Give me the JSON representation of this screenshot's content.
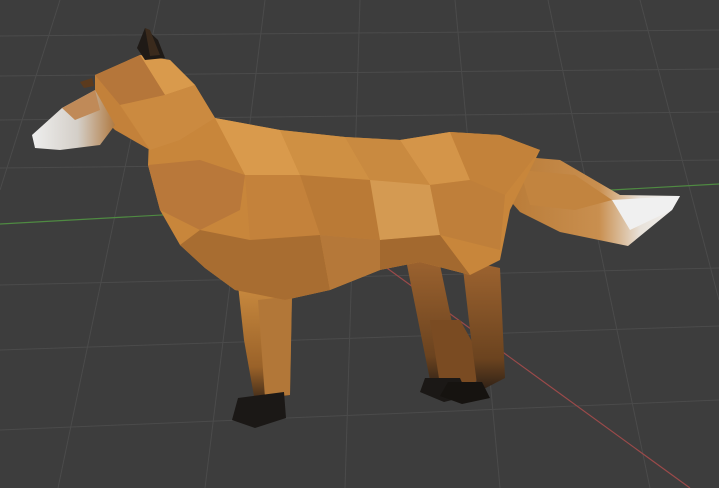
{
  "viewport": {
    "background_color": "#3d3d3d",
    "grid_color": "#4a4a4a",
    "x_axis_color": "#9b4a4a",
    "y_axis_color": "#4f8a42"
  },
  "model": {
    "object": "low-poly-fox",
    "body_color": "#c8863b",
    "highlight_color": "#dfa257",
    "shadow_color": "#8d5a27",
    "tail_tip_color": "#e9e9e9",
    "muzzle_color": "#d9d9d9",
    "ear_color": "#1f1a16",
    "paw_color": "#1b1816"
  }
}
